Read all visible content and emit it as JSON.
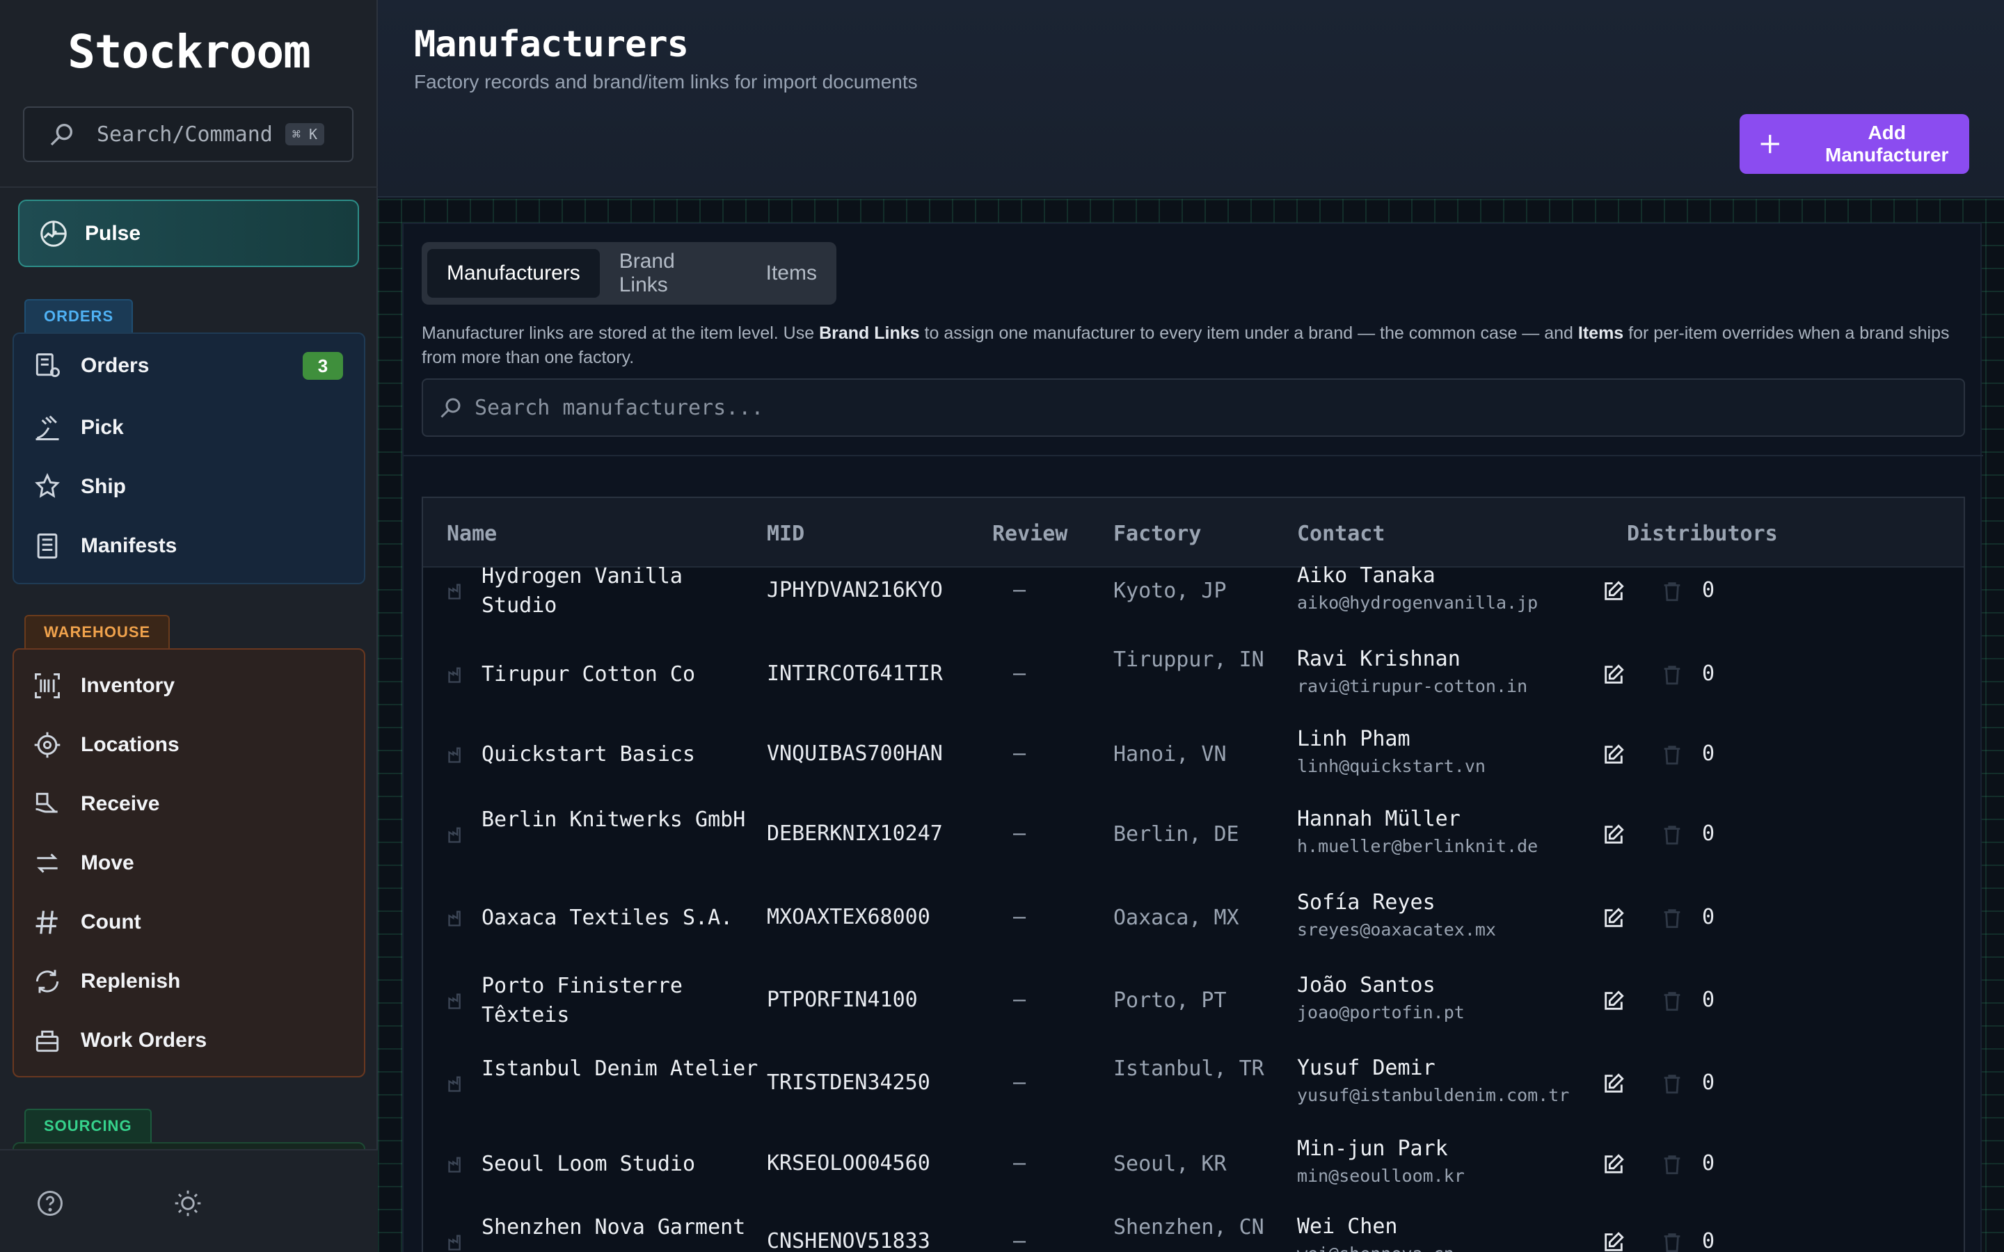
{
  "app": {
    "brand": "Stockroom"
  },
  "sidebar": {
    "search": {
      "label": "Search/Command",
      "shortcut": "⌘ K"
    },
    "pulse": {
      "label": "Pulse",
      "icon": "pulse-chart-icon"
    },
    "groups": {
      "orders": {
        "title": "ORDERS",
        "items": [
          {
            "label": "Orders",
            "icon": "orders-icon",
            "badge": "3"
          },
          {
            "label": "Pick",
            "icon": "pick-icon"
          },
          {
            "label": "Ship",
            "icon": "ship-icon"
          },
          {
            "label": "Manifests",
            "icon": "manifests-icon"
          }
        ]
      },
      "warehouse": {
        "title": "WAREHOUSE",
        "items": [
          {
            "label": "Inventory",
            "icon": "inventory-icon"
          },
          {
            "label": "Locations",
            "icon": "locations-icon"
          },
          {
            "label": "Receive",
            "icon": "receive-icon"
          },
          {
            "label": "Move",
            "icon": "move-icon"
          },
          {
            "label": "Count",
            "icon": "count-icon"
          },
          {
            "label": "Replenish",
            "icon": "replenish-icon"
          },
          {
            "label": "Work Orders",
            "icon": "work-orders-icon"
          }
        ]
      },
      "sourcing": {
        "title": "SOURCING"
      }
    },
    "footer": {
      "help_icon": "help-icon",
      "theme_icon": "sun-icon"
    }
  },
  "header": {
    "title": "Manufacturers",
    "subtitle": "Factory records and brand/item links for import documents",
    "add_button": "Add Manufacturer"
  },
  "tabs": [
    "Manufacturers",
    "Brand Links",
    "Items"
  ],
  "info": {
    "part1": "Manufacturer links are stored at the item level. Use ",
    "bold1": "Brand Links",
    "part2": " to assign one manufacturer to every item under a brand — the common case — and ",
    "bold2": "Items",
    "part3": " for per-item overrides when a brand ships from more than one factory."
  },
  "search": {
    "placeholder": "Search manufacturers..."
  },
  "table": {
    "columns": [
      "Name",
      "MID",
      "Review",
      "Factory",
      "Contact",
      "Distributors"
    ],
    "rows": [
      {
        "name": "Hydrogen Vanilla Studio",
        "mid": "JPHYDVAN216KYO",
        "review": "—",
        "factory": "Kyoto, JP",
        "contact_name": "Aiko Tanaka",
        "contact_email": "aiko@hydrogenvanilla.jp",
        "distributors": "0"
      },
      {
        "name": "Tirupur Cotton Co",
        "mid": "INTIRCOT641TIR",
        "review": "—",
        "factory": "Tiruppur, IN",
        "contact_name": "Ravi Krishnan",
        "contact_email": "ravi@tirupur-cotton.in",
        "distributors": "0"
      },
      {
        "name": "Quickstart Basics",
        "mid": "VNQUIBAS700HAN",
        "review": "—",
        "factory": "Hanoi, VN",
        "contact_name": "Linh Pham",
        "contact_email": "linh@quickstart.vn",
        "distributors": "0"
      },
      {
        "name": "Berlin Knitwerks GmbH",
        "mid": "DEBERKNIX10247",
        "review": "—",
        "factory": "Berlin, DE",
        "contact_name": "Hannah Müller",
        "contact_email": "h.mueller@berlinknit.de",
        "distributors": "0"
      },
      {
        "name": "Oaxaca Textiles S.A.",
        "mid": "MXOAXTEX68000",
        "review": "—",
        "factory": "Oaxaca, MX",
        "contact_name": "Sofía Reyes",
        "contact_email": "sreyes@oaxacatex.mx",
        "distributors": "0"
      },
      {
        "name": "Porto Finisterre Têxteis",
        "mid": "PTPORFIN4100",
        "review": "—",
        "factory": "Porto, PT",
        "contact_name": "João Santos",
        "contact_email": "joao@portofin.pt",
        "distributors": "0"
      },
      {
        "name": "Istanbul Denim Atelier",
        "mid": "TRISTDEN34250",
        "review": "—",
        "factory": "Istanbul, TR",
        "contact_name": "Yusuf Demir",
        "contact_email": "yusuf@istanbuldenim.com.tr",
        "distributors": "0"
      },
      {
        "name": "Seoul Loom Studio",
        "mid": "KRSEOLOO04560",
        "review": "—",
        "factory": "Seoul, KR",
        "contact_name": "Min-jun Park",
        "contact_email": "min@seoulloom.kr",
        "distributors": "0"
      },
      {
        "name": "Shenzhen Nova Garment",
        "mid": "CNSHENOV51833",
        "review": "—",
        "factory": "Shenzhen, CN",
        "contact_name": "Wei Chen",
        "contact_email": "wei@shennova.cn",
        "distributors": "0"
      }
    ]
  },
  "colors": {
    "accent": "#8b4cf0",
    "pulse": "#2d8e88",
    "orders": "#4fb1f4",
    "warehouse": "#f0a24c",
    "sourcing": "#36d28c",
    "badge": "#3f8f3c"
  }
}
